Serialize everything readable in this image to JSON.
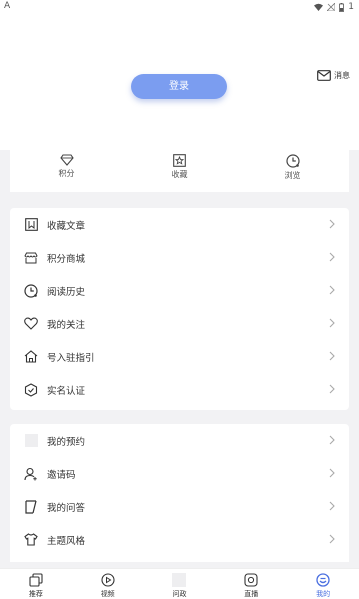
{
  "status": {
    "left": "A",
    "right": "1"
  },
  "header": {
    "login_label": "登录",
    "message_label": "消息"
  },
  "stats": [
    {
      "label": "积分",
      "icon": "diamond-icon"
    },
    {
      "label": "收藏",
      "icon": "star-frame-icon"
    },
    {
      "label": "浏览",
      "icon": "clock-icon"
    }
  ],
  "menu1": [
    {
      "label": "收藏文章",
      "icon": "bookmark-icon"
    },
    {
      "label": "积分商城",
      "icon": "shop-icon"
    },
    {
      "label": "阅读历史",
      "icon": "history-icon"
    },
    {
      "label": "我的关注",
      "icon": "heart-icon"
    },
    {
      "label": "号入驻指引",
      "icon": "home-icon"
    },
    {
      "label": "实名认证",
      "icon": "shield-check-icon"
    }
  ],
  "menu2": [
    {
      "label": "我的预约",
      "icon": "reservation-icon"
    },
    {
      "label": "邀请码",
      "icon": "user-add-icon"
    },
    {
      "label": "我的问答",
      "icon": "qa-icon"
    },
    {
      "label": "主题风格",
      "icon": "shirt-icon"
    }
  ],
  "tabs": [
    {
      "label": "推荐",
      "icon": "recommend-icon"
    },
    {
      "label": "视频",
      "icon": "video-icon"
    },
    {
      "label": "问政",
      "icon": "ask-icon"
    },
    {
      "label": "直播",
      "icon": "live-icon"
    },
    {
      "label": "我的",
      "icon": "profile-icon",
      "active": true
    }
  ],
  "colors": {
    "accent": "#4a6fe0",
    "login_bg": "#7b9df0"
  }
}
